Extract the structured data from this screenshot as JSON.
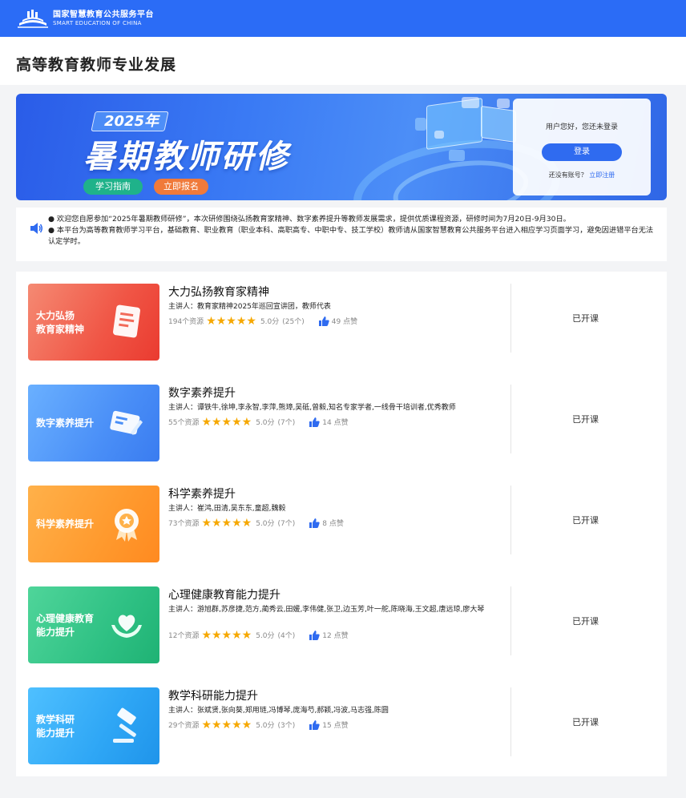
{
  "header": {
    "logo_cn": "国家智慧教育公共服务平台",
    "logo_en": "SMART EDUCATION OF CHINA",
    "brand_color": "#2b6cf6"
  },
  "page": {
    "title": "高等教育教师专业发展"
  },
  "banner": {
    "year": "2025年",
    "headline": "暑期教师研修",
    "guide_button": "学习指南",
    "signup_button": "立即报名"
  },
  "login": {
    "greeting": "用户您好，您还未登录",
    "login_button": "登录",
    "no_account": "还没有账号？",
    "register_link": "立即注册"
  },
  "notice": {
    "icon": "speaker-icon",
    "lines": [
      "● 欢迎您自愿参加“2025年暑期教师研修”，本次研修围绕弘扬教育家精神、数字素养提升等教师发展需求，提供优质课程资源，研修时间为7月20日-9月30日。",
      "● 本平台为高等教育教师学习平台，基础教育、职业教育（职业本科、高职高专、中职中专、技工学校）教师请从国家智慧教育公共服务平台进入相应学习页面学习，避免因进错平台无法认定学时。"
    ]
  },
  "courses": [
    {
      "cover_title": "大力弘扬\n教育家精神",
      "cover_icon": "document-icon",
      "title": "大力弘扬教育家精神",
      "speaker": "主讲人：教育家精神2025年巡回宣讲团，教师代表",
      "resources": "194个资源",
      "score": "5.0分",
      "ratings": "(25个)",
      "likes": "49 点赞",
      "status": "已开课"
    },
    {
      "cover_title": "数字素养提升",
      "cover_icon": "card-pen-icon",
      "title": "数字素养提升",
      "speaker": "主讲人：谭铁牛,徐坤,李永智,李萍,熊璋,吴砥,曾毅,知名专家学者,一线骨干培训者,优秀教师",
      "resources": "55个资源",
      "score": "5.0分",
      "ratings": "(7个)",
      "likes": "14 点赞",
      "status": "已开课"
    },
    {
      "cover_title": "科学素养提升",
      "cover_icon": "medal-icon",
      "title": "科学素养提升",
      "speaker": "主讲人：崔鸿,田清,吴东东,童超,魏毅",
      "resources": "73个资源",
      "score": "5.0分",
      "ratings": "(7个)",
      "likes": "8 点赞",
      "status": "已开课"
    },
    {
      "cover_title": "心理健康教育\n能力提升",
      "cover_icon": "heart-hands-icon",
      "title": "心理健康教育能力提升",
      "speaker": "主讲人：游旭群,苏彦捷,范方,蔺秀云,田媛,李伟健,张卫,边玉芳,叶一舵,陈晓海,王文超,唐远琼,廖大琴",
      "resources": "12个资源",
      "score": "5.0分",
      "ratings": "(4个)",
      "likes": "12 点赞",
      "status": "已开课"
    },
    {
      "cover_title": "教学科研\n能力提升",
      "cover_icon": "gavel-icon",
      "title": "教学科研能力提升",
      "speaker": "主讲人：张斌贤,张向葵,郑用琏,冯博琴,庞海芍,郝颖,冯波,马志强,陈圆",
      "resources": "29个资源",
      "score": "5.0分",
      "ratings": "(3个)",
      "likes": "15 点赞",
      "status": "已开课"
    }
  ]
}
